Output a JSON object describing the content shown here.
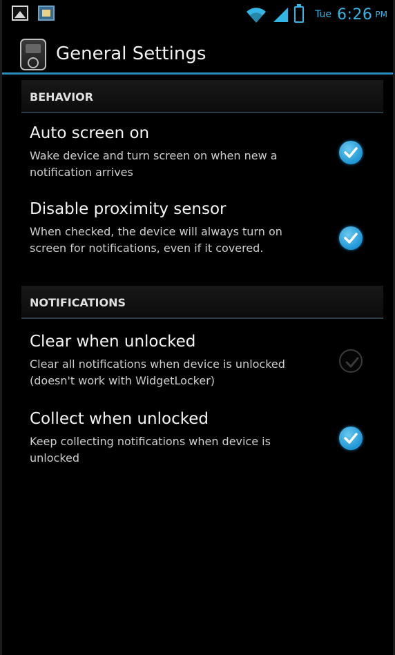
{
  "status_bar": {
    "day": "Tue",
    "time": "6:26",
    "ampm": "PM",
    "icons": [
      "gallery-icon",
      "app-notification-icon",
      "wifi-icon",
      "signal-icon",
      "battery-icon"
    ],
    "accent_color": "#33b5e5"
  },
  "action_bar": {
    "title": "General Settings",
    "icon": "app-icon",
    "divider_color": "#2a8fbd"
  },
  "sections": [
    {
      "header": "BEHAVIOR",
      "items": [
        {
          "title": "Auto screen on",
          "summary": "Wake device and turn screen on when new a notification arrives",
          "checked": true
        },
        {
          "title": "Disable proximity sensor",
          "summary": "When checked, the device will always turn on screen for notifications, even if it covered.",
          "checked": true
        }
      ]
    },
    {
      "header": "NOTIFICATIONS",
      "items": [
        {
          "title": "Clear when unlocked",
          "summary": "Clear all notifications when device is unlocked (doesn't work with WidgetLocker)",
          "checked": false
        },
        {
          "title": "Collect when unlocked",
          "summary": "Keep collecting notifications when device is unlocked",
          "checked": true
        }
      ]
    }
  ],
  "colors": {
    "checkbox_on": "#1e96d6",
    "background": "#000000",
    "text": "#f4f4f4"
  }
}
